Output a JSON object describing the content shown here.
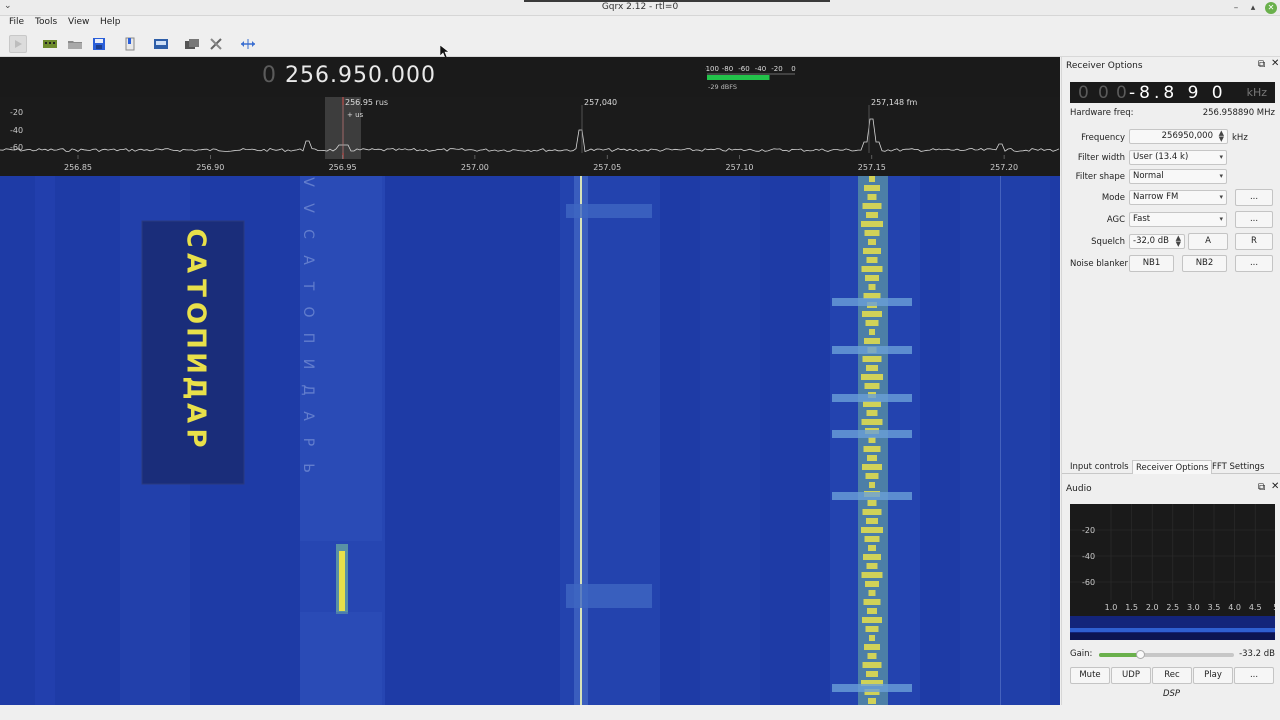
{
  "window": {
    "title": "Gqrx 2.12 - rtl=0",
    "controls": {
      "minimize": "–",
      "maximize": "▴",
      "close": "✕"
    }
  },
  "menu": [
    "File",
    "Tools",
    "View",
    "Help"
  ],
  "toolbar": {
    "icons": [
      "play-icon",
      "device-icon",
      "open-icon",
      "save-icon",
      "bookmark-icon",
      "screenshot-icon",
      "remote-icon",
      "settings-icon",
      "fit-icon"
    ]
  },
  "freq_display": {
    "leading_digit": "0",
    "value": "256.950.000"
  },
  "smeter": {
    "scale": [
      "-100",
      "-80",
      "-60",
      "-40",
      "-20",
      "0"
    ],
    "readout": "-29 dBFS",
    "level_dbfs": -29
  },
  "spectrum": {
    "y_ticks": [
      "-20",
      "-40",
      "-60"
    ],
    "x_ticks": [
      "256.85",
      "256.90",
      "256.95",
      "257.00",
      "257.05",
      "257.10",
      "257.15",
      "257.20"
    ],
    "markers": [
      {
        "label": "256.95 rus",
        "sublabel": "+ us"
      },
      {
        "label": "257,040",
        "sublabel": ""
      },
      {
        "label": "257,148 fm",
        "sublabel": ""
      }
    ]
  },
  "waterfall": {
    "overlay_text": "САТО ПИДАР",
    "colors": {
      "background": "#1e3ba6",
      "signal": "#e8e04a",
      "signal_mid": "#6fb0a0"
    }
  },
  "receiver_options": {
    "title": "Receiver Options",
    "lnb_display": {
      "dim_digits": [
        "0",
        "0",
        "0"
      ],
      "value": "-8.8 9 0",
      "unit": "kHz"
    },
    "hardware_freq_label": "Hardware freq:",
    "hardware_freq_value": "256.958890 MHz",
    "frequency_label": "Frequency",
    "frequency_value": "256950,000",
    "frequency_unit": "kHz",
    "filter_width_label": "Filter width",
    "filter_width_value": "User (13.4 k)",
    "filter_shape_label": "Filter shape",
    "filter_shape_value": "Normal",
    "mode_label": "Mode",
    "mode_value": "Narrow FM",
    "agc_label": "AGC",
    "agc_value": "Fast",
    "squelch_label": "Squelch",
    "squelch_value": "-32,0 dB",
    "squelch_btn_a": "A",
    "squelch_btn_r": "R",
    "noise_blanker_label": "Noise blanker",
    "nb1": "NB1",
    "nb2": "NB2",
    "more": "..."
  },
  "tabs": [
    "Input controls",
    "Receiver Options",
    "FFT Settings"
  ],
  "audio": {
    "title": "Audio",
    "y_ticks": [
      "-20",
      "-40",
      "-60"
    ],
    "x_ticks": [
      "1.0",
      "1.5",
      "2.0",
      "2.5",
      "3.0",
      "3.5",
      "4.0",
      "4.5",
      "5"
    ],
    "gain_label": "Gain:",
    "gain_value": "-33.2 dB",
    "gain_fraction": 0.3,
    "buttons": [
      "Mute",
      "UDP",
      "Rec",
      "Play",
      "..."
    ],
    "dsp_label": "DSP"
  },
  "colors": {
    "accent": "#2b5fd9",
    "meter_green": "#22c24a",
    "waterfall_blue": "#1e3ba6"
  }
}
